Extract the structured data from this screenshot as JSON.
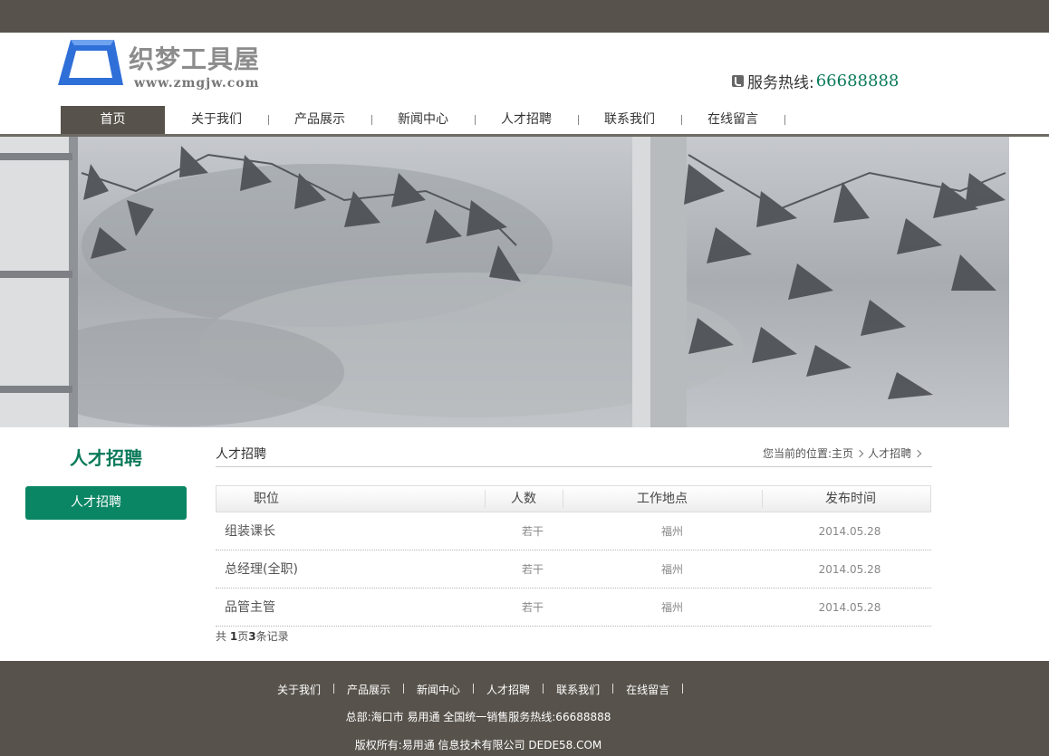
{
  "header": {
    "logo_text": "织梦工具屋",
    "logo_domain": "www.zmgjw.com",
    "hotline_label": "服务热线:",
    "hotline_number": "66688888"
  },
  "nav": {
    "items": [
      {
        "label": "首页",
        "active": true
      },
      {
        "label": "关于我们",
        "active": false
      },
      {
        "label": "产品展示",
        "active": false
      },
      {
        "label": "新闻中心",
        "active": false
      },
      {
        "label": "人才招聘",
        "active": false
      },
      {
        "label": "联系我们",
        "active": false
      },
      {
        "label": "在线留言",
        "active": false
      }
    ]
  },
  "sidebar": {
    "title": "人才招聘",
    "button_label": "人才招聘"
  },
  "main": {
    "title": "人才招聘",
    "breadcrumb_prefix": "您当前的位置:",
    "breadcrumb_home": "主页",
    "breadcrumb_current": "人才招聘",
    "table": {
      "headers": [
        "职位",
        "人数",
        "工作地点",
        "发布时间"
      ],
      "rows": [
        [
          "组装课长",
          "若干",
          "福州",
          "2014.05.28"
        ],
        [
          "总经理(全职)",
          "若干",
          "福州",
          "2014.05.28"
        ],
        [
          "品管主管",
          "若干",
          "福州",
          "2014.05.28"
        ]
      ]
    },
    "pager": {
      "prefix": "共 ",
      "pages": "1",
      "mid": "页",
      "records": "3",
      "suffix": "条记录"
    }
  },
  "footer": {
    "links": [
      "关于我们",
      "产品展示",
      "新闻中心",
      "人才招聘",
      "联系我们",
      "在线留言"
    ],
    "address_line": "总部:海口市 易用通   全国统一销售服务热线:66688888",
    "copyright_line": "版权所有:易用通 信息技术有限公司 DEDE58.COM"
  },
  "colors": {
    "accent_green": "#0a8664",
    "dark_bar": "#57524b"
  }
}
